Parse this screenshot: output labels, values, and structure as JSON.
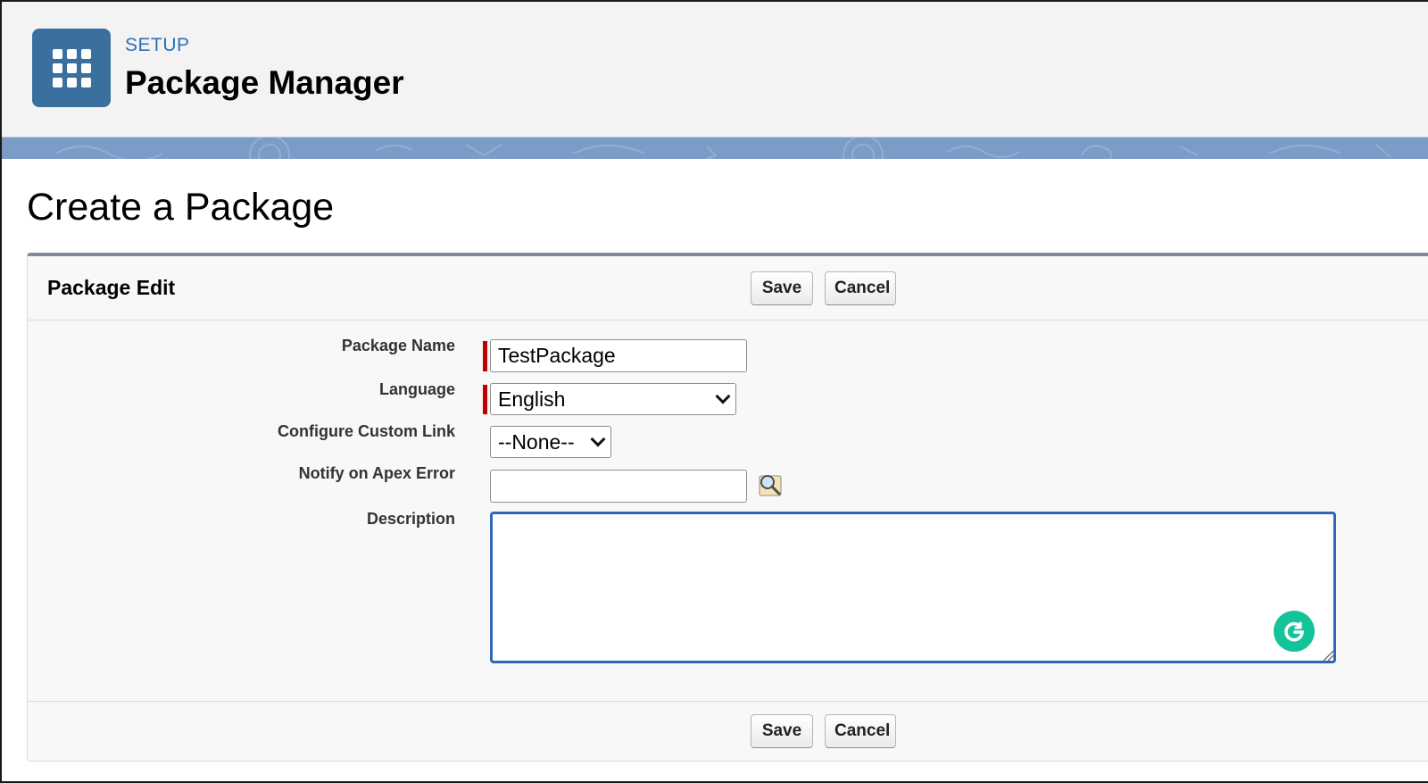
{
  "header": {
    "eyebrow": "SETUP",
    "title": "Package Manager",
    "icon": "app-launcher-grid-icon",
    "accent_color": "#3a6f9e",
    "band_color": "#7b9cc7"
  },
  "page": {
    "title": "Create a Package"
  },
  "panel": {
    "title": "Package Edit",
    "save_label": "Save",
    "cancel_label": "Cancel"
  },
  "form": {
    "package_name": {
      "label": "Package Name",
      "value": "TestPackage",
      "required": true
    },
    "language": {
      "label": "Language",
      "selected": "English",
      "required": true
    },
    "custom_link": {
      "label": "Configure Custom Link",
      "selected": "--None--"
    },
    "apex_error": {
      "label": "Notify on Apex Error",
      "value": "",
      "lookup_icon": "lookup-magnifier-icon"
    },
    "description": {
      "label": "Description",
      "value": "",
      "assistant_icon": "grammarly-icon",
      "assistant_color": "#15c39a"
    }
  },
  "colors": {
    "required_marker": "#c00000",
    "focus_border": "#2f67b6"
  }
}
